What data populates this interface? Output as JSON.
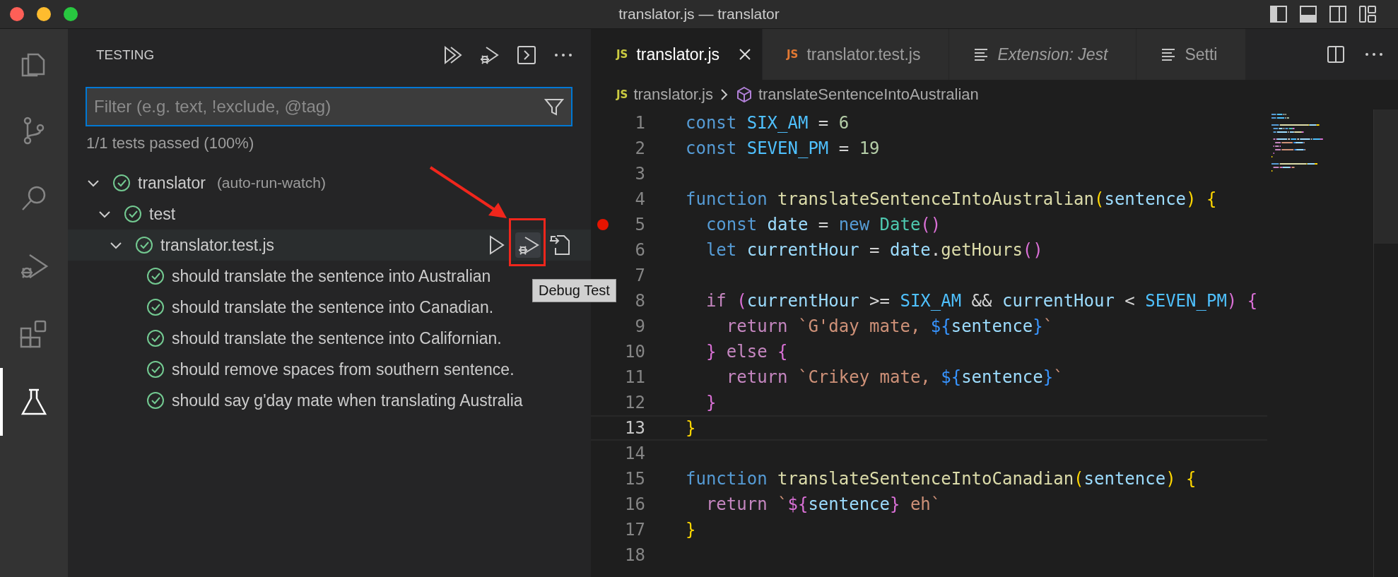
{
  "window": {
    "title": "translator.js — translator"
  },
  "activity_bar": [
    {
      "kind": "files",
      "selected": false
    },
    {
      "kind": "scm",
      "selected": false
    },
    {
      "kind": "search",
      "selected": false
    },
    {
      "kind": "debug",
      "selected": false
    },
    {
      "kind": "extensions",
      "selected": false
    },
    {
      "kind": "testing",
      "selected": true
    }
  ],
  "sidebar": {
    "title": "TESTING",
    "filter": {
      "placeholder": "Filter (e.g. text, !exclude, @tag)"
    },
    "summary": "1/1 tests passed (100%)",
    "tree": [
      {
        "label": "translator",
        "description": "(auto-run-watch)",
        "passed": true,
        "expanded": true,
        "hovered": false,
        "children": [
          {
            "label": "test",
            "passed": true,
            "expanded": true,
            "hovered": false,
            "children": [
              {
                "label": "translator.test.js",
                "passed": true,
                "expanded": true,
                "hovered": true,
                "children": [
                  {
                    "label": "should translate the sentence into Australian",
                    "passed": true,
                    "hovered": false
                  },
                  {
                    "label": "should translate the sentence into Canadian.",
                    "passed": true,
                    "hovered": false
                  },
                  {
                    "label": "should translate the sentence into Californian.",
                    "passed": true,
                    "hovered": false
                  },
                  {
                    "label": "should remove spaces from southern sentence.",
                    "passed": true,
                    "hovered": false
                  },
                  {
                    "label": "should say g'day mate when translating Australia",
                    "passed": true,
                    "hovered": false
                  }
                ]
              }
            ]
          }
        ]
      }
    ],
    "tooltip": "Debug Test"
  },
  "editor": {
    "tabs": [
      {
        "label": "translator.js",
        "kind": "js",
        "icon_text": "JS",
        "color": "#cbcb41",
        "selected": true,
        "preview": false,
        "closable": true
      },
      {
        "label": "translator.test.js",
        "kind": "js",
        "icon_text": "JS",
        "color": "#e37933",
        "selected": false,
        "preview": false,
        "closable": false
      },
      {
        "label": "Extension: Jest",
        "kind": "doc",
        "color": "#c5c5c5",
        "selected": false,
        "preview": true,
        "closable": false
      },
      {
        "label": "Setti",
        "kind": "doc",
        "color": "#c5c5c5",
        "selected": false,
        "preview": false,
        "closable": false
      }
    ],
    "breadcrumb": {
      "icon_text": "JS",
      "file": "translator.js",
      "symbol": "translateSentenceIntoAustralian"
    },
    "lines": [
      {
        "number": "1",
        "breakpoint": false,
        "current": false,
        "tokens": [
          {
            "text": "const ",
            "kind": "kw"
          },
          {
            "text": "SIX_AM",
            "kind": "const"
          },
          {
            "text": " = ",
            "kind": "op"
          },
          {
            "text": "6",
            "kind": "num"
          }
        ]
      },
      {
        "number": "2",
        "breakpoint": false,
        "current": false,
        "tokens": [
          {
            "text": "const ",
            "kind": "kw"
          },
          {
            "text": "SEVEN_PM",
            "kind": "const"
          },
          {
            "text": " = ",
            "kind": "op"
          },
          {
            "text": "19",
            "kind": "num"
          }
        ]
      },
      {
        "number": "3",
        "breakpoint": false,
        "current": false
      },
      {
        "number": "4",
        "breakpoint": false,
        "current": false,
        "tokens": [
          {
            "text": "function ",
            "kind": "kw"
          },
          {
            "text": "translateSentenceIntoAustralian",
            "kind": "fn"
          },
          {
            "text": "(",
            "kind": "b1"
          },
          {
            "text": "sentence",
            "kind": "param"
          },
          {
            "text": ") {",
            "kind": "b1"
          }
        ]
      },
      {
        "number": "5",
        "breakpoint": true,
        "current": false,
        "tokens": [
          {
            "text": "  const ",
            "kind": "kw"
          },
          {
            "text": "date",
            "kind": "param"
          },
          {
            "text": " = ",
            "kind": "op"
          },
          {
            "text": "new ",
            "kind": "kw"
          },
          {
            "text": "Date",
            "kind": "cls"
          },
          {
            "text": "()",
            "kind": "b2"
          }
        ]
      },
      {
        "number": "6",
        "breakpoint": false,
        "current": false,
        "tokens": [
          {
            "text": "  let ",
            "kind": "kw"
          },
          {
            "text": "currentHour",
            "kind": "param"
          },
          {
            "text": " = ",
            "kind": "op"
          },
          {
            "text": "date",
            "kind": "param"
          },
          {
            "text": ".",
            "kind": "op"
          },
          {
            "text": "getHours",
            "kind": "fn"
          },
          {
            "text": "()",
            "kind": "b2"
          }
        ]
      },
      {
        "number": "7",
        "breakpoint": false,
        "current": false
      },
      {
        "number": "8",
        "breakpoint": false,
        "current": false,
        "tokens": [
          {
            "text": "  if ",
            "kind": "ctl"
          },
          {
            "text": "(",
            "kind": "b2"
          },
          {
            "text": "currentHour",
            "kind": "param"
          },
          {
            "text": " >= ",
            "kind": "op"
          },
          {
            "text": "SIX_AM",
            "kind": "const"
          },
          {
            "text": " && ",
            "kind": "op"
          },
          {
            "text": "currentHour",
            "kind": "param"
          },
          {
            "text": " < ",
            "kind": "op"
          },
          {
            "text": "SEVEN_PM",
            "kind": "const"
          },
          {
            "text": ") {",
            "kind": "b2"
          }
        ]
      },
      {
        "number": "9",
        "breakpoint": false,
        "current": false,
        "tokens": [
          {
            "text": "    return ",
            "kind": "ctl"
          },
          {
            "text": "`G'day mate, ",
            "kind": "str"
          },
          {
            "text": "${",
            "kind": "tpl"
          },
          {
            "text": "sentence",
            "kind": "param"
          },
          {
            "text": "}",
            "kind": "tpl"
          },
          {
            "text": "`",
            "kind": "str"
          }
        ]
      },
      {
        "number": "10",
        "breakpoint": false,
        "current": false,
        "tokens": [
          {
            "text": "  } ",
            "kind": "b2"
          },
          {
            "text": "else ",
            "kind": "ctl"
          },
          {
            "text": "{",
            "kind": "b2"
          }
        ]
      },
      {
        "number": "11",
        "breakpoint": false,
        "current": false,
        "tokens": [
          {
            "text": "    return ",
            "kind": "ctl"
          },
          {
            "text": "`Crikey mate, ",
            "kind": "str"
          },
          {
            "text": "${",
            "kind": "tpl"
          },
          {
            "text": "sentence",
            "kind": "param"
          },
          {
            "text": "}",
            "kind": "tpl"
          },
          {
            "text": "`",
            "kind": "str"
          }
        ]
      },
      {
        "number": "12",
        "breakpoint": false,
        "current": false,
        "tokens": [
          {
            "text": "  }",
            "kind": "b2"
          }
        ]
      },
      {
        "number": "13",
        "breakpoint": false,
        "current": true,
        "tokens": [
          {
            "text": "}",
            "kind": "b1"
          }
        ]
      },
      {
        "number": "14",
        "breakpoint": false,
        "current": false
      },
      {
        "number": "15",
        "breakpoint": false,
        "current": false,
        "tokens": [
          {
            "text": "function ",
            "kind": "kw"
          },
          {
            "text": "translateSentenceIntoCanadian",
            "kind": "fn"
          },
          {
            "text": "(",
            "kind": "b1"
          },
          {
            "text": "sentence",
            "kind": "param"
          },
          {
            "text": ") {",
            "kind": "b1"
          }
        ]
      },
      {
        "number": "16",
        "breakpoint": false,
        "current": false,
        "tokens": [
          {
            "text": "  return ",
            "kind": "ctl"
          },
          {
            "text": "`",
            "kind": "str"
          },
          {
            "text": "${",
            "kind": "b2"
          },
          {
            "text": "sentence",
            "kind": "param"
          },
          {
            "text": "}",
            "kind": "b2"
          },
          {
            "text": " eh`",
            "kind": "str"
          }
        ]
      },
      {
        "number": "17",
        "breakpoint": false,
        "current": false,
        "tokens": [
          {
            "text": "}",
            "kind": "b1"
          }
        ]
      },
      {
        "number": "18",
        "breakpoint": false,
        "current": false
      }
    ]
  }
}
